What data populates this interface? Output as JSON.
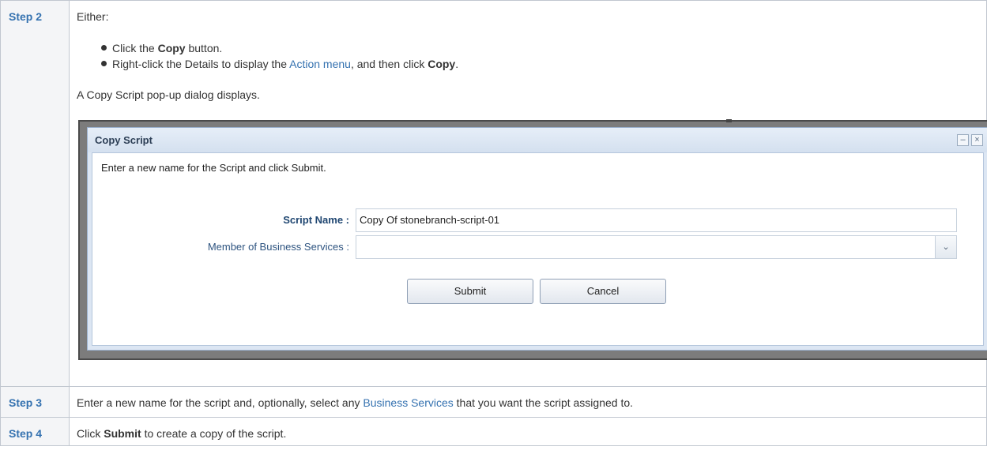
{
  "steps": [
    {
      "label": "Step 2",
      "intro": "Either:",
      "bullets": [
        {
          "pre": "Click the ",
          "bold": "Copy",
          "post": " button."
        },
        {
          "pre": "Right-click the Details to display the ",
          "link": "Action menu",
          "mid": ", and then click ",
          "bold": "Copy",
          "post": "."
        }
      ],
      "after": "A Copy Script pop-up dialog displays."
    },
    {
      "label": "Step 3",
      "pre": "Enter a new name for the script and, optionally, select any ",
      "link": "Business Services",
      "post": " that you want the script assigned to."
    },
    {
      "label": "Step 4",
      "pre": "Click ",
      "bold": "Submit",
      "post": " to create a copy of the script."
    }
  ],
  "dialog": {
    "title": "Copy Script",
    "minimize_glyph": "–",
    "close_glyph": "×",
    "message": "Enter a new name for the Script and click Submit.",
    "script_name_label": "Script Name :",
    "script_name_value": "Copy Of stonebranch-script-01",
    "business_services_label": "Member of Business Services :",
    "business_services_value": "",
    "dropdown_glyph": "⌄",
    "submit_label": "Submit",
    "cancel_label": "Cancel"
  },
  "colors": {
    "link": "#3572b0",
    "step_label": "#3572b0",
    "label_cell_bg": "#f4f5f7"
  }
}
